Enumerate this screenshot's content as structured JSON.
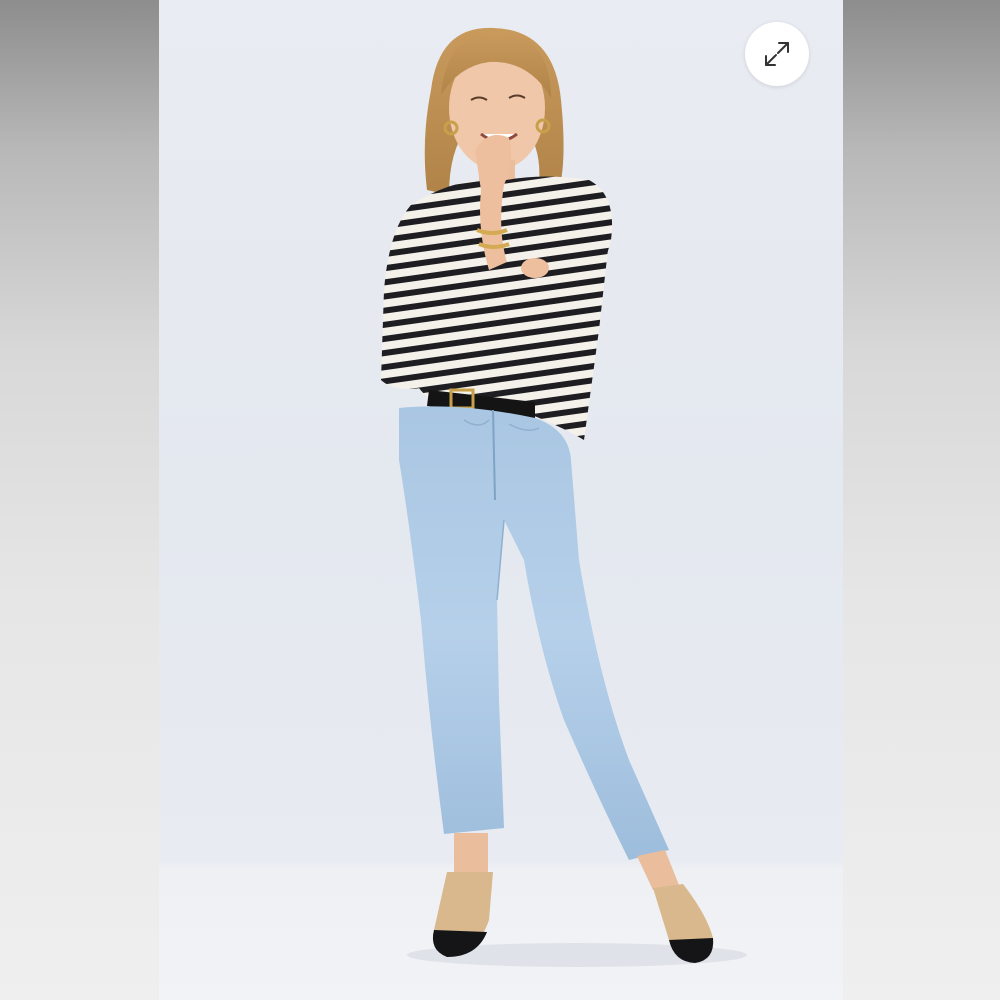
{
  "viewer": {
    "image_subject": "model-striped-top-light-wash-jeans",
    "expand_icon": "expand-arrows-icon"
  },
  "colors": {
    "background": "#e6e9ef",
    "side_panel": "#d9d9d9",
    "button": "#ffffff",
    "icon": "#333333"
  }
}
